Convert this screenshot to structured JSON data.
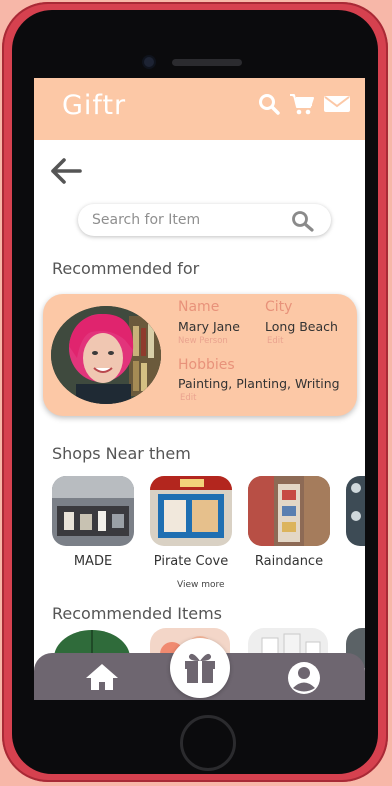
{
  "app": {
    "title": "Giftr"
  },
  "header": {
    "icons": [
      "search-icon",
      "cart-icon",
      "mail-icon"
    ]
  },
  "search": {
    "placeholder": "Search for Item"
  },
  "recommended": {
    "title": "Recommended for",
    "person": {
      "name_label": "Name",
      "name": "Mary Jane",
      "new_person": "New Person",
      "city_label": "City",
      "city": "Long Beach",
      "city_edit": "Edit",
      "hobbies_label": "Hobbies",
      "hobbies": "Painting, Planting, Writing",
      "hobbies_edit": "Edit"
    }
  },
  "shops": {
    "title": "Shops Near them",
    "items": [
      {
        "name": "MADE"
      },
      {
        "name": "Pirate Cove"
      },
      {
        "name": "Raindance"
      }
    ],
    "view_more": "View more"
  },
  "recommended_items": {
    "title": "Recommended Items"
  },
  "tabbar": {
    "icons": [
      "home-icon",
      "gift-icon",
      "profile-icon"
    ]
  },
  "colors": {
    "accent": "#fcc8a6",
    "frame": "#d6414f",
    "tabbar": "#6e6670"
  }
}
